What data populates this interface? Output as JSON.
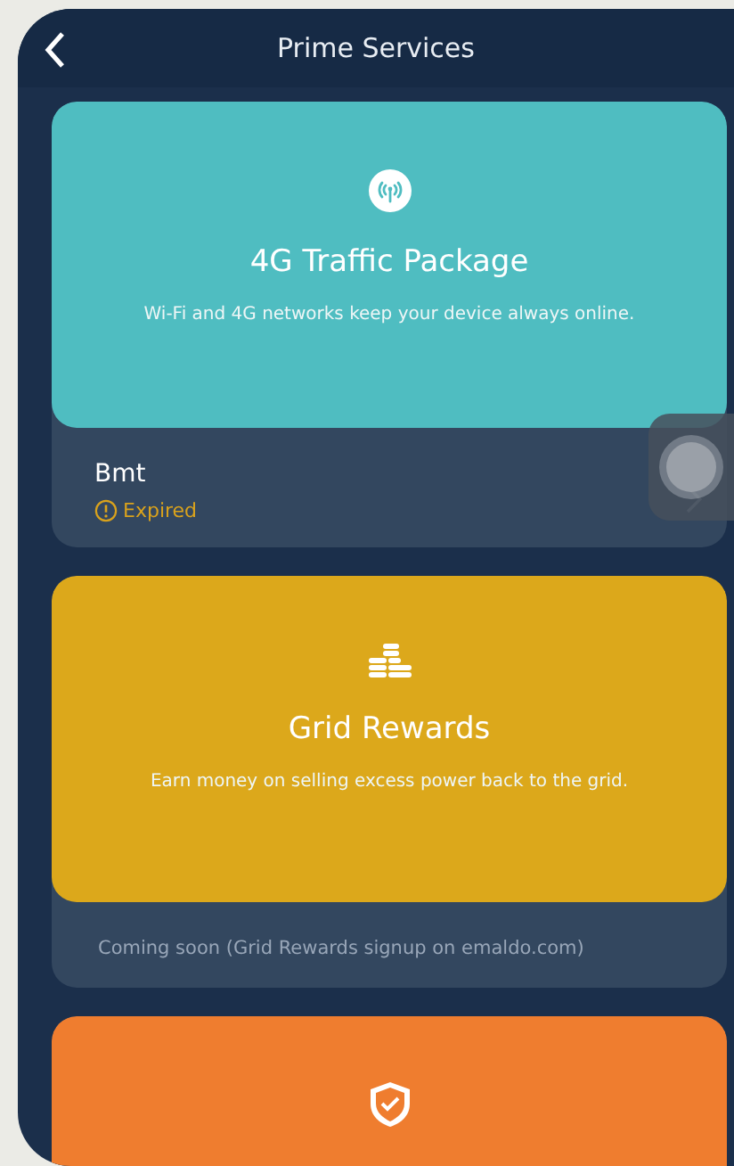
{
  "header": {
    "title": "Prime Services"
  },
  "services": [
    {
      "kind": "antenna",
      "title": "4G Traffic Package",
      "description": "Wi-Fi and 4G networks keep your device always online.",
      "color": "#4fbdc1",
      "footer": {
        "kind": "status",
        "name": "Bmt",
        "status": "Expired"
      }
    },
    {
      "kind": "coins",
      "title": "Grid Rewards",
      "description": "Earn money on selling excess power back to the grid.",
      "color": "#dca81b",
      "footer": {
        "kind": "note",
        "text": "Coming soon  (Grid Rewards signup on emaldo.com)"
      }
    },
    {
      "kind": "shield",
      "color": "#ef7d2f"
    }
  ]
}
